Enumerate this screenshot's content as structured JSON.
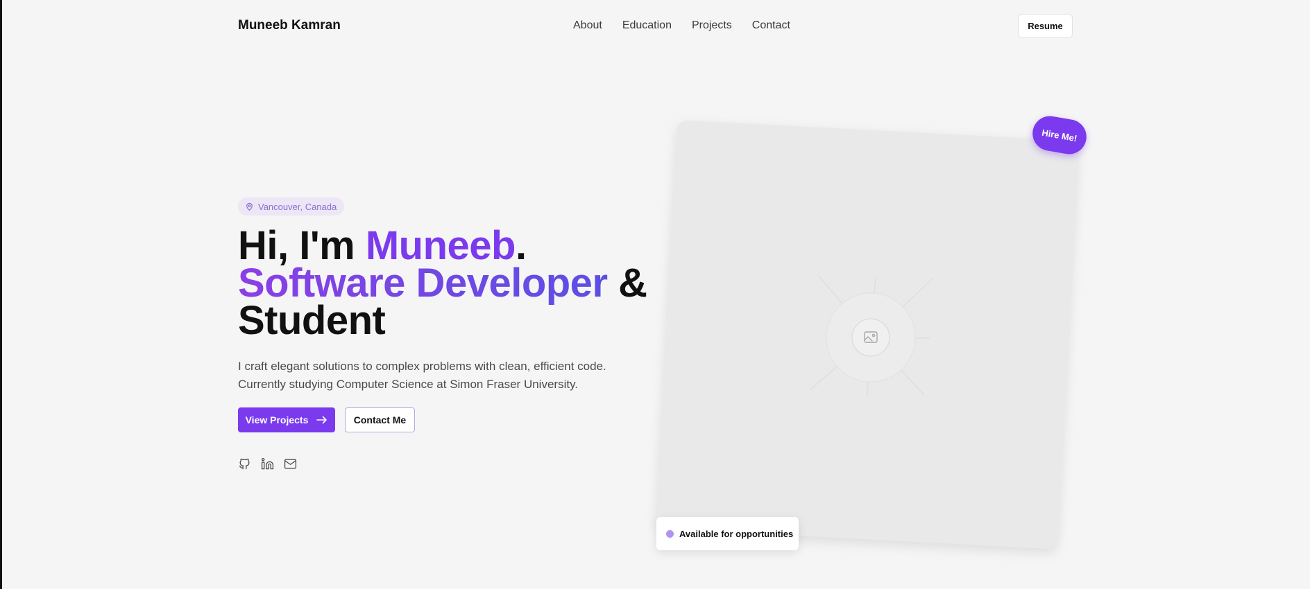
{
  "nav": {
    "brand": "Muneeb Kamran",
    "links": [
      "About",
      "Education",
      "Projects",
      "Contact"
    ],
    "resume_label": "Resume"
  },
  "hero": {
    "location": "Vancouver, Canada",
    "headline": {
      "greeting": "Hi, I'm ",
      "name": "Muneeb",
      "period": ".",
      "role": "Software Developer",
      "amp": " &",
      "line3": "Student"
    },
    "lead_line1": "I craft elegant solutions to complex problems with clean, efficient code.",
    "lead_line2": "Currently studying Computer Science at Simon Fraser University.",
    "primary_button": "View Projects",
    "secondary_button": "Contact Me",
    "socials": [
      "github-icon",
      "linkedin-icon",
      "mail-icon"
    ]
  },
  "aside": {
    "hire_badge": "Hire Me!",
    "availability": "Available for opportunities",
    "image_placeholder_icon": "image-icon"
  },
  "colors": {
    "accent": "#7b3aed",
    "accent_gradient_end": "#5b4fe3",
    "background": "#f5f5f5",
    "card": "#e9e9e9"
  }
}
